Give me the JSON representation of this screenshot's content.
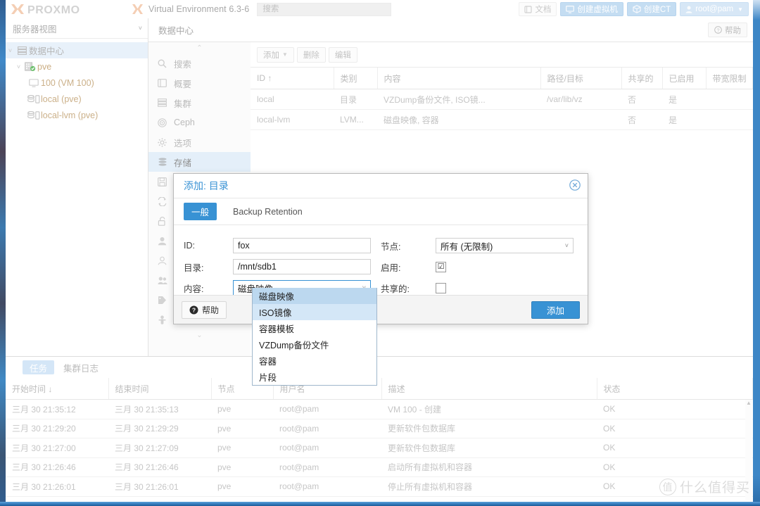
{
  "header": {
    "brand": "PROXMOX",
    "product": "Virtual Environment 6.3-6",
    "search_placeholder": "搜索",
    "buttons": {
      "docs": "文档",
      "create_vm": "创建虚拟机",
      "create_ct": "创建CT",
      "user": "root@pam"
    }
  },
  "sidebar": {
    "view_label": "服务器视图",
    "tree": [
      {
        "label": "数据中心",
        "icon": "datacenter-icon",
        "level": 0,
        "selected": true,
        "caret": "˅"
      },
      {
        "label": "pve",
        "icon": "node-icon",
        "level": 1,
        "selected": false,
        "caret": "˅"
      },
      {
        "label": "100 (VM 100)",
        "icon": "vm-icon",
        "level": 2,
        "selected": false,
        "caret": ""
      },
      {
        "label": "local (pve)",
        "icon": "storage-icon",
        "level": 2,
        "selected": false,
        "caret": ""
      },
      {
        "label": "local-lvm (pve)",
        "icon": "storage-icon",
        "level": 2,
        "selected": false,
        "caret": ""
      }
    ]
  },
  "nav": {
    "items": [
      {
        "label": "搜索",
        "icon": "search-icon",
        "selected": false
      },
      {
        "label": "概要",
        "icon": "book-icon",
        "selected": false
      },
      {
        "label": "集群",
        "icon": "cluster-icon",
        "selected": false
      },
      {
        "label": "Ceph",
        "icon": "ceph-icon",
        "selected": false
      },
      {
        "label": "选项",
        "icon": "gear-icon",
        "selected": false
      },
      {
        "label": "存储",
        "icon": "storage-icon",
        "selected": true
      },
      {
        "label": "备份",
        "icon": "floppy-icon",
        "selected": false
      },
      {
        "label": "复制",
        "icon": "replication-icon",
        "selected": false
      },
      {
        "label": "权限",
        "icon": "lock-icon",
        "selected": false
      },
      {
        "label": "用户",
        "icon": "user-icon",
        "selected": false
      },
      {
        "label": "API令牌",
        "icon": "user-outline-icon",
        "selected": false
      },
      {
        "label": "群组",
        "icon": "group-icon",
        "selected": false
      },
      {
        "label": "池",
        "icon": "tag-icon",
        "selected": false
      },
      {
        "label": "角色",
        "icon": "role-icon",
        "selected": false
      }
    ]
  },
  "breadcrumb": {
    "text": "数据中心",
    "help": "帮助"
  },
  "storage": {
    "toolbar": {
      "add": "添加",
      "remove": "删除",
      "edit": "编辑"
    },
    "columns": [
      "ID ↑",
      "类别",
      "内容",
      "路径/目标",
      "共享的",
      "已启用",
      "带宽限制"
    ],
    "rows": [
      {
        "id": "local",
        "type": "目录",
        "content": "VZDump备份文件, ISO镜...",
        "path": "/var/lib/vz",
        "shared": "否",
        "enabled": "是",
        "bwlimit": ""
      },
      {
        "id": "local-lvm",
        "type": "LVM...",
        "content": "磁盘映像, 容器",
        "path": "",
        "shared": "否",
        "enabled": "是",
        "bwlimit": ""
      }
    ]
  },
  "dialog": {
    "title": "添加: 目录",
    "tabs": [
      {
        "label": "一般",
        "active": true
      },
      {
        "label": "Backup Retention",
        "active": false
      }
    ],
    "fields": {
      "id_label": "ID:",
      "id_value": "fox",
      "dir_label": "目录:",
      "dir_value": "/mnt/sdb1",
      "content_label": "内容:",
      "content_value": "磁盘映像",
      "node_label": "节点:",
      "node_value": "所有 (无限制)",
      "enable_label": "启用:",
      "enable_checked": "☑",
      "shared_label": "共享的:",
      "shared_checked": ""
    },
    "dropdown_options": [
      {
        "label": "磁盘映像",
        "state": "selected"
      },
      {
        "label": "ISO镜像",
        "state": "hover"
      },
      {
        "label": "容器模板",
        "state": ""
      },
      {
        "label": "VZDump备份文件",
        "state": ""
      },
      {
        "label": "容器",
        "state": ""
      },
      {
        "label": "片段",
        "state": ""
      }
    ],
    "footer": {
      "help": "帮助",
      "submit": "添加"
    },
    "accent_color": "#3892d4"
  },
  "tasks": {
    "tabs": [
      {
        "label": "任务",
        "active": true
      },
      {
        "label": "集群日志",
        "active": false
      }
    ],
    "columns": [
      "开始时间 ↓",
      "结束时间",
      "节点",
      "用户名",
      "描述",
      "状态"
    ],
    "rows": [
      {
        "start": "三月 30 21:35:12",
        "end": "三月 30 21:35:13",
        "node": "pve",
        "user": "root@pam",
        "desc": "VM 100 - 创建",
        "status": "OK"
      },
      {
        "start": "三月 30 21:29:20",
        "end": "三月 30 21:29:29",
        "node": "pve",
        "user": "root@pam",
        "desc": "更新软件包数据库",
        "status": "OK"
      },
      {
        "start": "三月 30 21:27:00",
        "end": "三月 30 21:27:09",
        "node": "pve",
        "user": "root@pam",
        "desc": "更新软件包数据库",
        "status": "OK"
      },
      {
        "start": "三月 30 21:26:46",
        "end": "三月 30 21:26:46",
        "node": "pve",
        "user": "root@pam",
        "desc": "启动所有虚拟机和容器",
        "status": "OK"
      },
      {
        "start": "三月 30 21:26:01",
        "end": "三月 30 21:26:01",
        "node": "pve",
        "user": "root@pam",
        "desc": "停止所有虚拟机和容器",
        "status": "OK"
      }
    ]
  },
  "watermark": {
    "mark": "值",
    "text": "什么值得买"
  }
}
